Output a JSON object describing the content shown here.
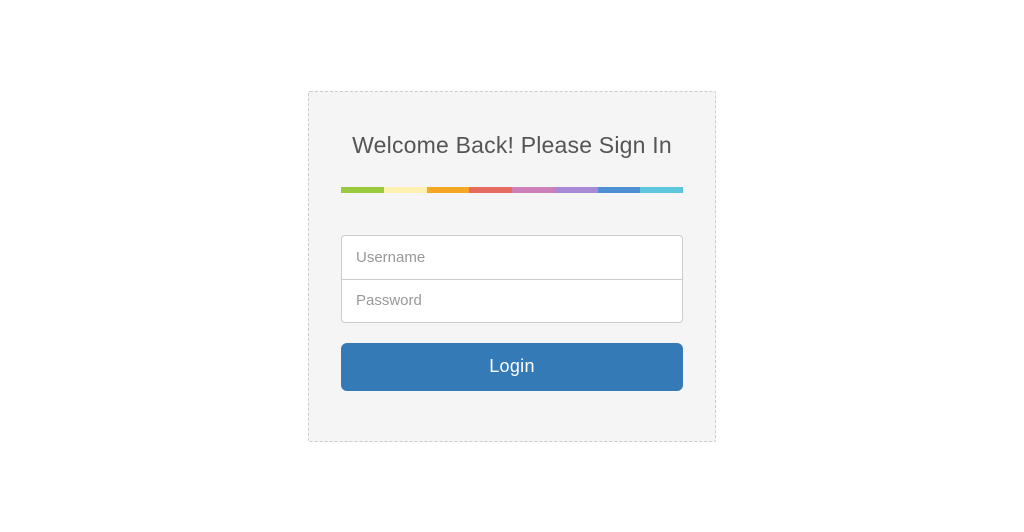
{
  "login": {
    "title": "Welcome Back! Please Sign In",
    "username_placeholder": "Username",
    "password_placeholder": "Password",
    "button_label": "Login",
    "stripe_colors": [
      "#99c93c",
      "#fdf0b1",
      "#f5a623",
      "#e66a60",
      "#cd7fb9",
      "#a889d6",
      "#4f8fd4",
      "#5ec6dc"
    ]
  }
}
